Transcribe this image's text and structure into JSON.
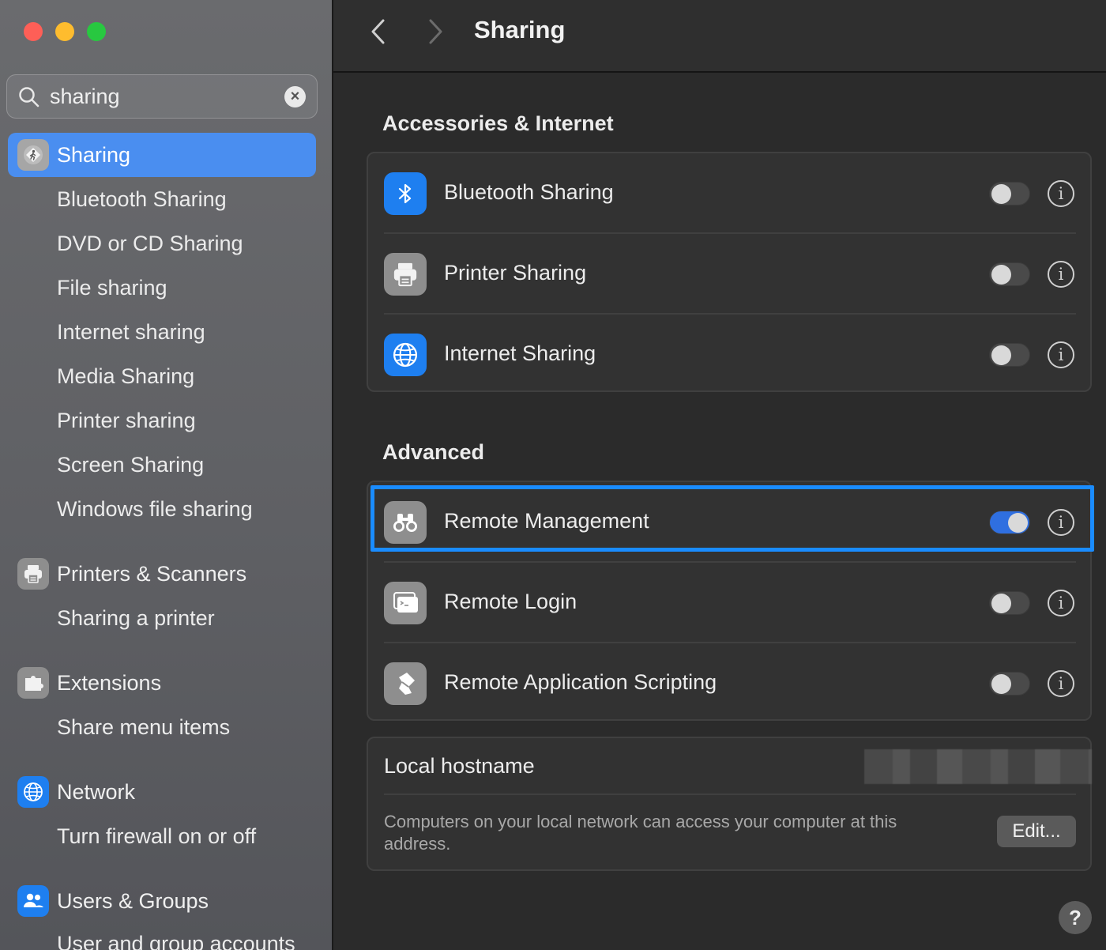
{
  "colors": {
    "sidebar_selected": "#4a8ef0",
    "toggle_on": "#2f6fe0",
    "highlight_border": "#1a8cff",
    "traffic_red": "#fe5f57",
    "traffic_yellow": "#febc2e",
    "traffic_green": "#28c840"
  },
  "window": {
    "traffic_lights": [
      "close",
      "minimize",
      "zoom"
    ]
  },
  "sidebar": {
    "search": {
      "value": "sharing",
      "icon": "magnifying-glass-icon",
      "clear_icon": "clear-x-icon"
    },
    "groups": [
      {
        "label": "Sharing",
        "icon": "sharing-walk-icon",
        "selected": true,
        "items": [
          "Bluetooth Sharing",
          "DVD or CD Sharing",
          "File sharing",
          "Internet sharing",
          "Media Sharing",
          "Printer sharing",
          "Screen Sharing",
          "Windows file sharing"
        ]
      },
      {
        "label": "Printers & Scanners",
        "icon": "printer-icon",
        "items": [
          "Sharing a printer"
        ]
      },
      {
        "label": "Extensions",
        "icon": "puzzle-icon",
        "items": [
          "Share menu items"
        ]
      },
      {
        "label": "Network",
        "icon": "globe-icon",
        "items": [
          "Turn firewall on or off"
        ]
      },
      {
        "label": "Users & Groups",
        "icon": "users-icon",
        "items": [
          "User and group accounts"
        ]
      }
    ]
  },
  "toolbar": {
    "title": "Sharing",
    "back_icon": "chevron-left-icon",
    "forward_icon": "chevron-right-icon"
  },
  "sections": {
    "accessories": {
      "title": "Accessories & Internet",
      "rows": [
        {
          "label": "Bluetooth Sharing",
          "icon": "bluetooth-icon",
          "on": false
        },
        {
          "label": "Printer Sharing",
          "icon": "printer-icon",
          "on": false
        },
        {
          "label": "Internet Sharing",
          "icon": "globe-icon",
          "on": false
        }
      ]
    },
    "advanced": {
      "title": "Advanced",
      "rows": [
        {
          "label": "Remote Management",
          "icon": "binoculars-icon",
          "on": true
        },
        {
          "label": "Remote Login",
          "icon": "terminal-icon",
          "on": false
        },
        {
          "label": "Remote Application Scripting",
          "icon": "script-icon",
          "on": false
        }
      ]
    }
  },
  "hostname": {
    "label": "Local hostname",
    "description": "Computers on your local network can access your computer at this address.",
    "edit_label": "Edit..."
  },
  "help": {
    "label": "?"
  },
  "info_glyph": "i"
}
